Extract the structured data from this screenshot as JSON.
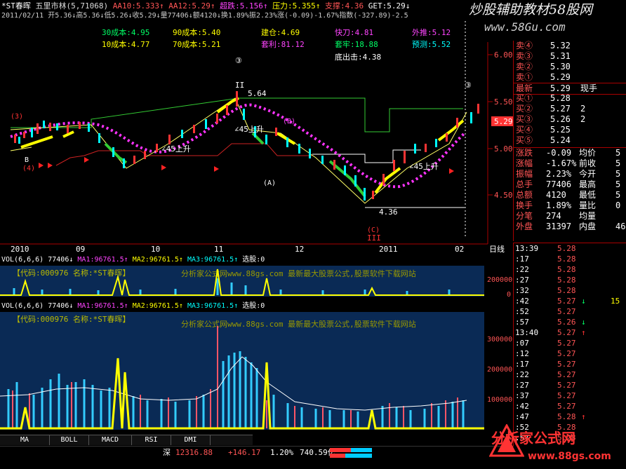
{
  "header": {
    "name": "*ST春晖",
    "title_rest": "五里市林(5,71068)",
    "aa10": "AA10:5.333↑",
    "aa12": "AA12:5.29↑",
    "chaodie": "超跌:5.156↑",
    "yali": "压力:5.355↑",
    "zhicheng": "支撑:4.36",
    "get": "GET:5.29↓",
    "info_line": "2011/02/11 开5.36↓高5.36↓低5.26↓收5.29↓量77406↓额4120↓换1.89%振2.23%涨(-0.09)-1.67%指数(-327.89)-2.5"
  },
  "overlay_labels": {
    "c30": "30成本:4.95",
    "c90": "90成本:5.40",
    "jiancang": "建仓:4.69",
    "kuaidao": "快刀:4.81",
    "waitui": "外推:5.12",
    "c10": "10成本:4.77",
    "c70": "70成本:5.21",
    "taoli": "套利:81.12",
    "taolao": "套牢:18.88",
    "yuce": "预测:5.52",
    "dichu": "底出击:4.38"
  },
  "price_axis": [
    "6.00",
    "5.50",
    "5.00",
    "4.50"
  ],
  "current_price_tag": "5.29",
  "chart_annotations": {
    "peak_label": "5.64",
    "low_label": "4.36",
    "roman_II": "II",
    "roman_III": "III",
    "up45_1": "∠45上升",
    "up45_2": "∠45上升",
    "up45_3": "∠45上升",
    "up45_4": "∠45上升",
    "circ3_a": "③",
    "circ3_b": "③",
    "circA": "(A)",
    "circB": "(B)",
    "circC": "(C)",
    "circ3_left": "(3)",
    "circ4_left": "(4)",
    "b_label": "B"
  },
  "date_axis": {
    "labels": [
      "2010",
      "09",
      "10",
      "11",
      "12",
      "2011",
      "02"
    ],
    "period": "日线"
  },
  "vol_panel_top": {
    "label": "VOL(6,6,6)",
    "v": "77406↓",
    "ma1": "MA1:96761.5↑",
    "ma2": "MA2:96761.5↑",
    "ma3": "MA3:96761.5↑",
    "xuangu": "选股:0",
    "code_line": "【代码:000976 名称:*ST春晖】",
    "watermark": "分析家公式网www.88gs.com 最新最大股票公式,股票软件下载网站",
    "axis": [
      "200000",
      "0"
    ]
  },
  "vol_panel_bottom": {
    "label": "VOL(6,6,6)",
    "v": "77406↓",
    "ma1": "MA1:96761.5↑",
    "ma2": "MA2:96761.5↑",
    "ma3": "MA3:96761.5↑",
    "xuangu": "选股:0",
    "code_line": "【代码:000976 名称:*ST春晖】",
    "watermark": "分析家公式网www.88gs.com 最新最大股票公式,股票软件下载网站",
    "axis": [
      "300000",
      "200000",
      "100000"
    ]
  },
  "tabs": [
    "MA",
    "BOLL",
    "MACD",
    "RSI",
    "DMI"
  ],
  "status_bar": {
    "market": "深",
    "index": "12316.88",
    "change": "+146.17",
    "pct": "1.20%",
    "amount": "740.59亿"
  },
  "watermarks": {
    "top_right": "炒股辅助教材58股网",
    "top_right_url": "www.58Gu.com",
    "bottom_right": "分析家公式网",
    "bottom_right_url": "www.88gs.com"
  },
  "order_book": [
    {
      "label": "卖④",
      "price": "5.32",
      "vol": "",
      "color": "#ff5555"
    },
    {
      "label": "卖③",
      "price": "5.31",
      "vol": "",
      "color": "#ff5555"
    },
    {
      "label": "卖②",
      "price": "5.30",
      "vol": "",
      "color": "#ff5555"
    },
    {
      "label": "卖①",
      "price": "5.29",
      "vol": "",
      "color": "#ff5555"
    },
    {
      "label": "最新",
      "price": "5.29",
      "vol": "现手",
      "color": "#ff5555"
    },
    {
      "label": "买①",
      "price": "5.28",
      "vol": "",
      "color": "#ff5555"
    },
    {
      "label": "买②",
      "price": "5.27",
      "vol": "2",
      "color": "#ff5555"
    },
    {
      "label": "买③",
      "price": "5.26",
      "vol": "2",
      "color": "#ff5555"
    },
    {
      "label": "买④",
      "price": "5.25",
      "vol": "",
      "color": "#ff5555"
    },
    {
      "label": "买⑤",
      "price": "5.24",
      "vol": "",
      "color": "#ff5555"
    }
  ],
  "stats": [
    {
      "k1": "涨跌",
      "v1": "-0.09",
      "k2": "均价",
      "v2": "5"
    },
    {
      "k1": "涨幅",
      "v1": "-1.67%",
      "k2": "前收",
      "v2": "5"
    },
    {
      "k1": "振幅",
      "v1": "2.23%",
      "k2": "今开",
      "v2": "5"
    },
    {
      "k1": "总手",
      "v1": "77406",
      "k2": "最高",
      "v2": "5"
    },
    {
      "k1": "总额",
      "v1": "4120",
      "k2": "最低",
      "v2": "5"
    },
    {
      "k1": "换手",
      "v1": "1.89%",
      "k2": "量比",
      "v2": "0"
    },
    {
      "k1": "分笔",
      "v1": "274",
      "k2": "均量",
      "v2": ""
    },
    {
      "k1": "外盘",
      "v1": "31397",
      "k2": "内盘",
      "v2": "46"
    }
  ],
  "ticks": [
    {
      "time": "13:39",
      "price": "5.28",
      "vol": "",
      "arrow": ""
    },
    {
      "time": ":17",
      "price": "5.28",
      "vol": "",
      "arrow": ""
    },
    {
      "time": ":22",
      "price": "5.28",
      "vol": "",
      "arrow": ""
    },
    {
      "time": ":27",
      "price": "5.28",
      "vol": "",
      "arrow": ""
    },
    {
      "time": ":32",
      "price": "5.28",
      "vol": "",
      "arrow": ""
    },
    {
      "time": ":42",
      "price": "5.27",
      "vol": "15",
      "arrow": "↓"
    },
    {
      "time": ":52",
      "price": "5.27",
      "vol": "",
      "arrow": ""
    },
    {
      "time": ":57",
      "price": "5.26",
      "vol": "",
      "arrow": "↓"
    },
    {
      "time": "13:40",
      "price": "5.27",
      "vol": "",
      "arrow": "↑"
    },
    {
      "time": ":07",
      "price": "5.27",
      "vol": "",
      "arrow": ""
    },
    {
      "time": ":12",
      "price": "5.27",
      "vol": "",
      "arrow": ""
    },
    {
      "time": ":17",
      "price": "5.27",
      "vol": "",
      "arrow": ""
    },
    {
      "time": ":22",
      "price": "5.27",
      "vol": "",
      "arrow": ""
    },
    {
      "time": ":27",
      "price": "5.27",
      "vol": "",
      "arrow": ""
    },
    {
      "time": ":37",
      "price": "5.27",
      "vol": "",
      "arrow": ""
    },
    {
      "time": ":42",
      "price": "5.27",
      "vol": "",
      "arrow": ""
    },
    {
      "time": ":47",
      "price": "5.28",
      "vol": "",
      "arrow": "↑"
    },
    {
      "time": ":52",
      "price": "5.28",
      "vol": "",
      "arrow": ""
    },
    {
      "time": ":57",
      "price": "5.28",
      "vol": "",
      "arrow": ""
    }
  ]
}
